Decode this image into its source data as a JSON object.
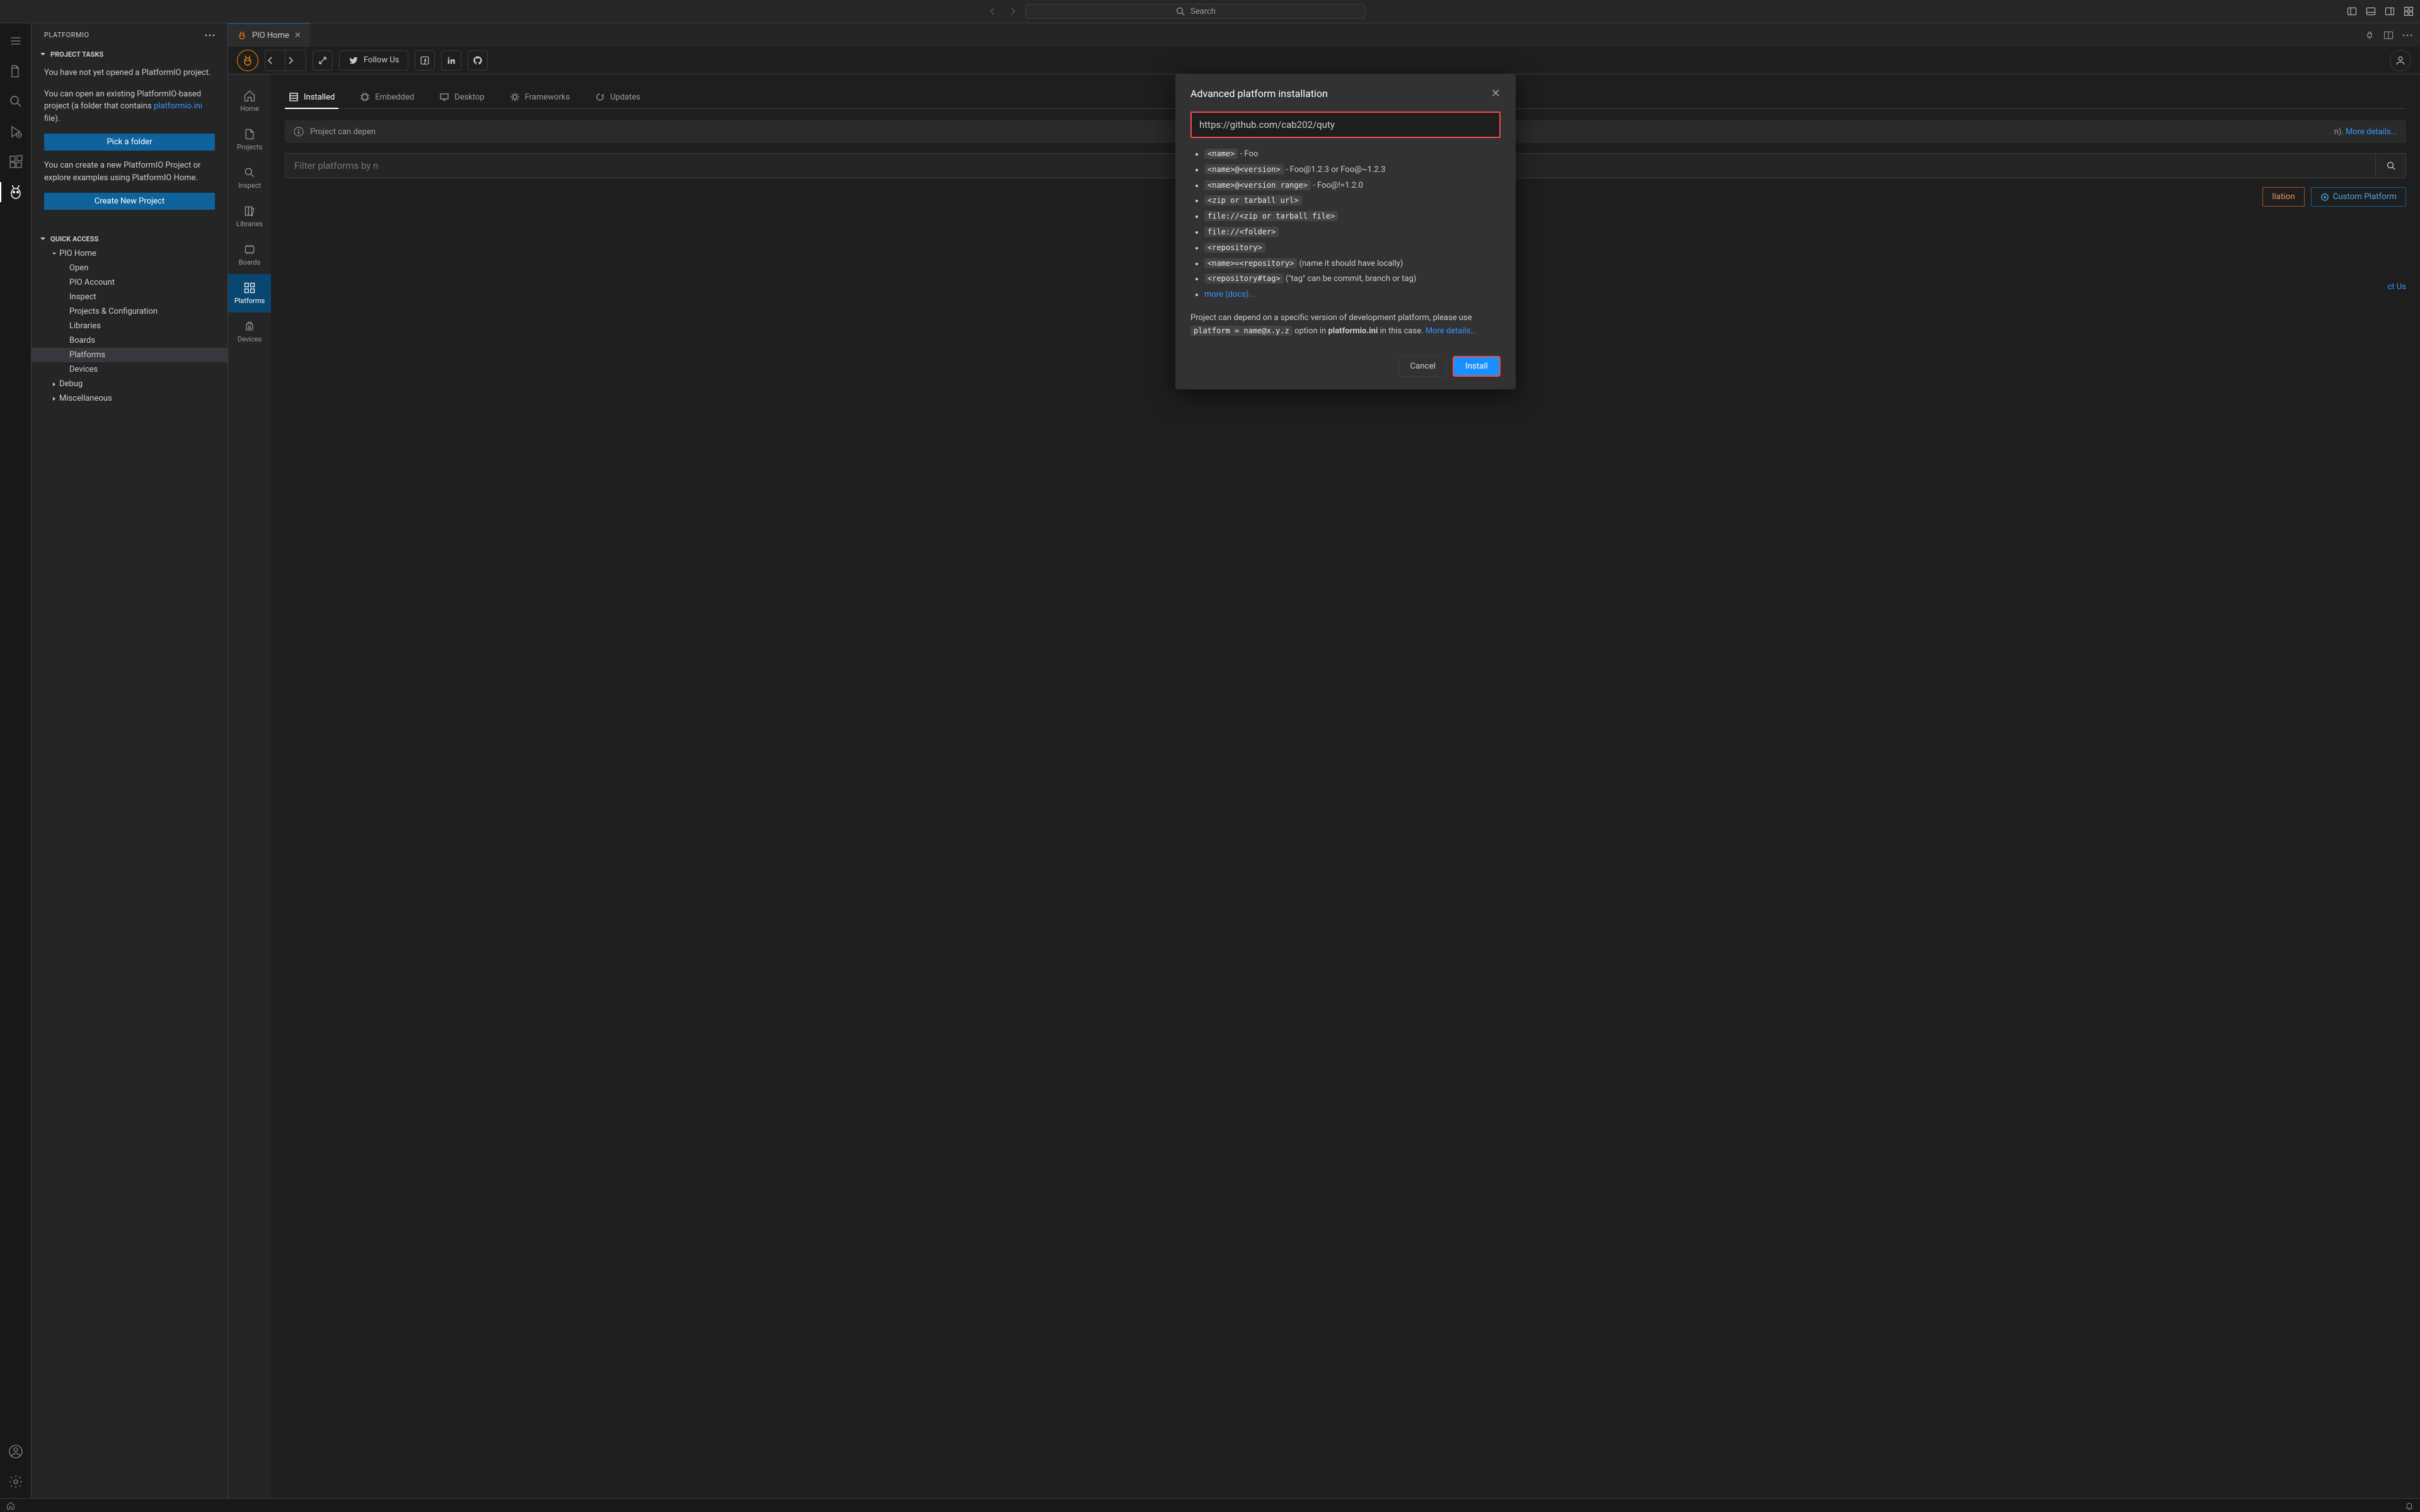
{
  "titlebar": {
    "search_placeholder": "Search"
  },
  "sidebar": {
    "title": "PLATFORMIO",
    "sections": {
      "project_tasks": "PROJECT TASKS",
      "quick_access": "QUICK ACCESS"
    },
    "msg1": "You have not yet opened a PlatformIO project.",
    "msg2_a": "You can open an existing PlatformIO-based project (a folder that contains ",
    "msg2_link": "platformio.ini",
    "msg2_b": " file).",
    "btn_pick": "Pick a folder",
    "msg3": "You can create a new PlatformIO Project or explore examples using PlatformIO Home.",
    "btn_create": "Create New Project",
    "qa": {
      "root": "PIO Home",
      "items": [
        "Open",
        "PIO Account",
        "Inspect",
        "Projects & Configuration",
        "Libraries",
        "Boards",
        "Platforms",
        "Devices"
      ],
      "debug": "Debug",
      "misc": "Miscellaneous"
    }
  },
  "tab": {
    "label": "PIO Home"
  },
  "pio_topbar": {
    "follow": "Follow Us"
  },
  "pio_sidenav": {
    "home": "Home",
    "projects": "Projects",
    "inspect": "Inspect",
    "libraries": "Libraries",
    "boards": "Boards",
    "platforms": "Platforms",
    "devices": "Devices"
  },
  "inner_tabs": {
    "installed": "Installed",
    "embedded": "Embedded",
    "desktop": "Desktop",
    "frameworks": "Frameworks",
    "updates": "Updates"
  },
  "banner": {
    "text_a": "Project can depen",
    "text_b": "n). ",
    "more": "More details..."
  },
  "filter_placeholder": "Filter platforms by n",
  "actions": {
    "advanced": "llation",
    "custom": "Custom Platform"
  },
  "footer_contact": "ct Us",
  "modal": {
    "title": "Advanced platform installation",
    "input_value": "https://github.com/cab202/quty",
    "items": [
      {
        "code": "<name>",
        "suffix": " - Foo"
      },
      {
        "code": "<name>@<version>",
        "suffix": " - Foo@1.2.3 or Foo@~1.2.3"
      },
      {
        "code": "<name>@<version range>",
        "suffix": " - Foo@!=1.2.0"
      },
      {
        "code": "<zip or tarball url>",
        "suffix": ""
      },
      {
        "code": "file://<zip or tarball file>",
        "suffix": ""
      },
      {
        "code": "file://<folder>",
        "suffix": ""
      },
      {
        "code": "<repository>",
        "suffix": ""
      },
      {
        "code": "<name>=<repository>",
        "suffix": " (name it should have locally)"
      },
      {
        "code": "<repository#tag>",
        "suffix": " (\"tag\" can be commit, branch or tag)"
      }
    ],
    "more_docs": "more (docs)...",
    "para_a": "Project can depend on a specific version of development platform, please use ",
    "para_code": "platform = name@x.y.z",
    "para_b": " option in ",
    "para_bold": "platformio.ini",
    "para_c": " in this case. ",
    "para_link": "More details...",
    "cancel": "Cancel",
    "install": "Install"
  }
}
